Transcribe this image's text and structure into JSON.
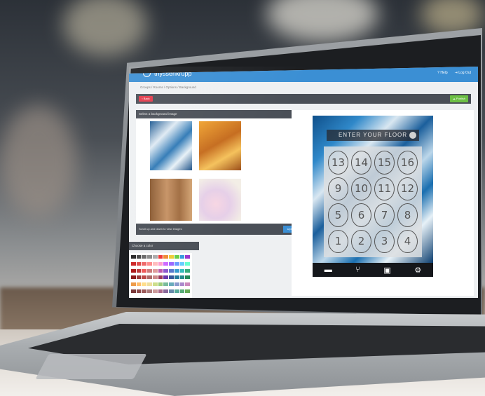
{
  "app": {
    "brand": "thyssenkrupp",
    "links": [
      "? Help",
      "⇥ Log Out"
    ]
  },
  "breadcrumb": "Groups / Rooms / Options / Background",
  "actions": {
    "back": "‹ Back",
    "publish": "☁ Publish"
  },
  "background_panel": {
    "header": "Select a background image",
    "footer": "Scroll up and down to view images",
    "upload": "Upload"
  },
  "color_panel": {
    "header": "Choose a color"
  },
  "preview": {
    "floor_prompt": "ENTER YOUR FLOOR",
    "keys": [
      "13",
      "14",
      "15",
      "16",
      "9",
      "10",
      "11",
      "12",
      "5",
      "6",
      "7",
      "8",
      "1",
      "2",
      "3",
      "4"
    ],
    "nav_icons": [
      "minus-icon",
      "chair-icon",
      "door-icon",
      "gear-icon"
    ]
  },
  "colors": {
    "accent": "#3b8fd4",
    "back": "#e33a4b",
    "publish": "#6cbf44",
    "bar": "#4a4f57"
  }
}
